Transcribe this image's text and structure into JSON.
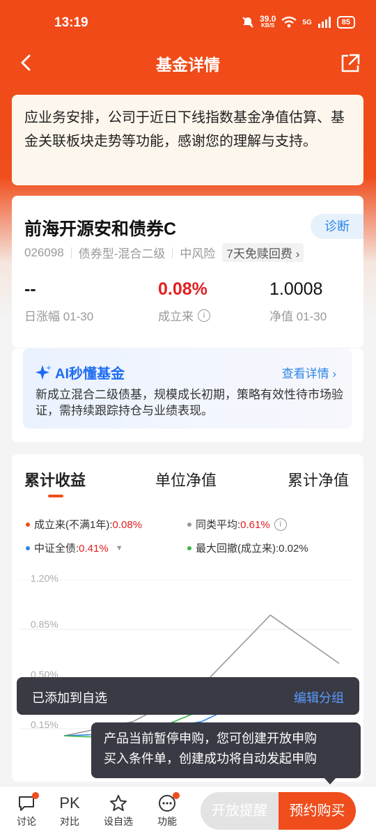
{
  "status_bar": {
    "time": "13:19",
    "speed": "39.0",
    "speed_unit": "KB/S",
    "network": "5G",
    "battery": "85"
  },
  "nav": {
    "title": "基金详情"
  },
  "notice": {
    "text": "应业务安排，公司于近日下线指数基金净值估算、基金关联板块走势等功能，感谢您的理解与支持。"
  },
  "fund": {
    "name": "前海开源安和债券C",
    "diagnose_label": "诊断",
    "code": "026098",
    "type": "债券型-混合二级",
    "risk": "中风险",
    "fee_tag": "7天免赎回费",
    "daily_change": {
      "value": "--",
      "label": "日涨幅 01-30"
    },
    "since_inception": {
      "value": "0.08%",
      "label": "成立来"
    },
    "nav": {
      "value": "1.0008",
      "label": "净值 01-30"
    }
  },
  "ai": {
    "title": "AI秒懂基金",
    "link": "查看详情",
    "text": "新成立混合二级债基，规模成长初期，策略有效性待市场验证，需持续跟踪持仓与业绩表现。"
  },
  "chart_tabs": [
    "累计收益",
    "单位净值",
    "累计净值"
  ],
  "legend": {
    "fund": {
      "label": "成立来(不满1年):",
      "value": "0.08%",
      "color": "#ef4d1c"
    },
    "peer": {
      "label": "同类平均:",
      "value": "0.61%",
      "color": "#999999"
    },
    "index": {
      "label": "中证全债:",
      "value": "0.41%",
      "color": "#2f86e6"
    },
    "drawdown": {
      "label": "最大回撤(成立来):",
      "value": "0.02%",
      "color": "#3cb44b"
    }
  },
  "chart_data": {
    "type": "line",
    "y_tick_labels": [
      "1.20%",
      "0.85%",
      "0.50%",
      "0.15%"
    ],
    "ylim": [
      0.15,
      1.2
    ],
    "series": [
      {
        "name": "同类平均",
        "color": "#999999",
        "values": [
          0.1,
          0.2,
          0.45,
          0.95,
          0.61
        ]
      },
      {
        "name": "中证全债",
        "color": "#2f86e6",
        "values": [
          0.1,
          0.12,
          0.2,
          0.43,
          0.41
        ]
      },
      {
        "name": "成立来(不满1年)",
        "color": "#3cb44b",
        "values": [
          0.1,
          0.08,
          0.28,
          0.45,
          0.5
        ]
      }
    ]
  },
  "toast": {
    "message": "已添加到自选",
    "action": "编辑分组"
  },
  "tooltip": {
    "line1": "产品当前暂停申购，您可创建开放申购",
    "line2": "买入条件单，创建成功将自动发起申购"
  },
  "bottom_bar": {
    "discuss": "讨论",
    "compare_icon_text": "PK",
    "compare": "对比",
    "watchlist": "设自选",
    "functions": "功能",
    "remind_button": "开放提醒",
    "buy_button": "预约购买"
  },
  "colors": {
    "brand": "#ef4d1c",
    "link": "#2f86e6",
    "toast_bg": "#393a44"
  }
}
